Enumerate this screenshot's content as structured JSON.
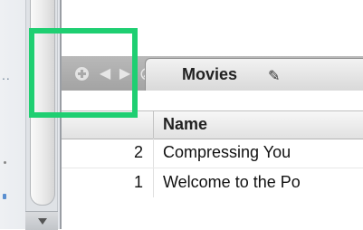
{
  "sidebar": {
    "dots": "..",
    "scroll_down_icon": "chevron-down-icon"
  },
  "tab_bar": {
    "buttons": [
      {
        "icon": "plus-circle-icon"
      },
      {
        "icon": "back-arrow-icon",
        "glyph": "◀"
      },
      {
        "icon": "forward-arrow-icon",
        "glyph": "▶"
      },
      {
        "icon": "stop-icon",
        "glyph": "⊘"
      }
    ],
    "active_tab": {
      "label": "Movies",
      "edit_icon": "✎"
    }
  },
  "table": {
    "columns": [
      "",
      "Name"
    ],
    "rows": [
      {
        "index": "2",
        "name": "Compressing You"
      },
      {
        "index": "1",
        "name": "Welcome to the Po"
      }
    ]
  },
  "highlight": {
    "color": "#1fcf72"
  }
}
